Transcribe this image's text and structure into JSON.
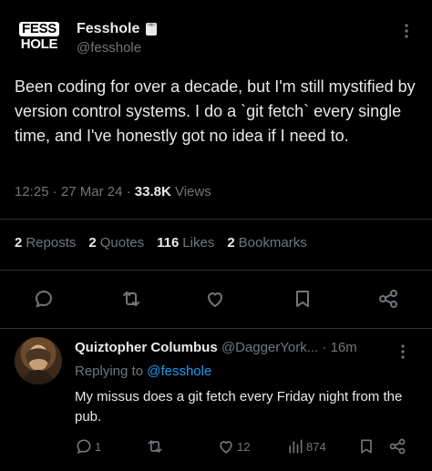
{
  "tweet": {
    "logo": {
      "line1": "FESS",
      "line2": "HOLE"
    },
    "author_name": "Fesshole",
    "author_badge": "toilet-roll-emoji",
    "author_handle": "@fesshole",
    "text": "Been coding for over a decade, but I'm still mystified by version control systems. I do a `git fetch` every single time, and I've honestly got no idea if I need to.",
    "time": "12:25",
    "date": "27 Mar 24",
    "views_count": "33.8K",
    "views_label": "Views",
    "stats": {
      "reposts_count": "2",
      "reposts_label": "Reposts",
      "quotes_count": "2",
      "quotes_label": "Quotes",
      "likes_count": "116",
      "likes_label": "Likes",
      "bookmarks_count": "2",
      "bookmarks_label": "Bookmarks"
    }
  },
  "reply": {
    "author_name": "Quiztopher Columbus",
    "author_handle": "@DaggerYork...",
    "time": "16m",
    "replying_prefix": "Replying to",
    "replying_to": "@fesshole",
    "text": "My missus does a git fetch every Friday night from the pub.",
    "comments_count": "1",
    "likes_count": "12",
    "views_count": "874"
  },
  "colors": {
    "background": "#000000",
    "text": "#e7e9ea",
    "muted": "#71767b",
    "link": "#1d9bf0",
    "divider": "#2f3336"
  }
}
